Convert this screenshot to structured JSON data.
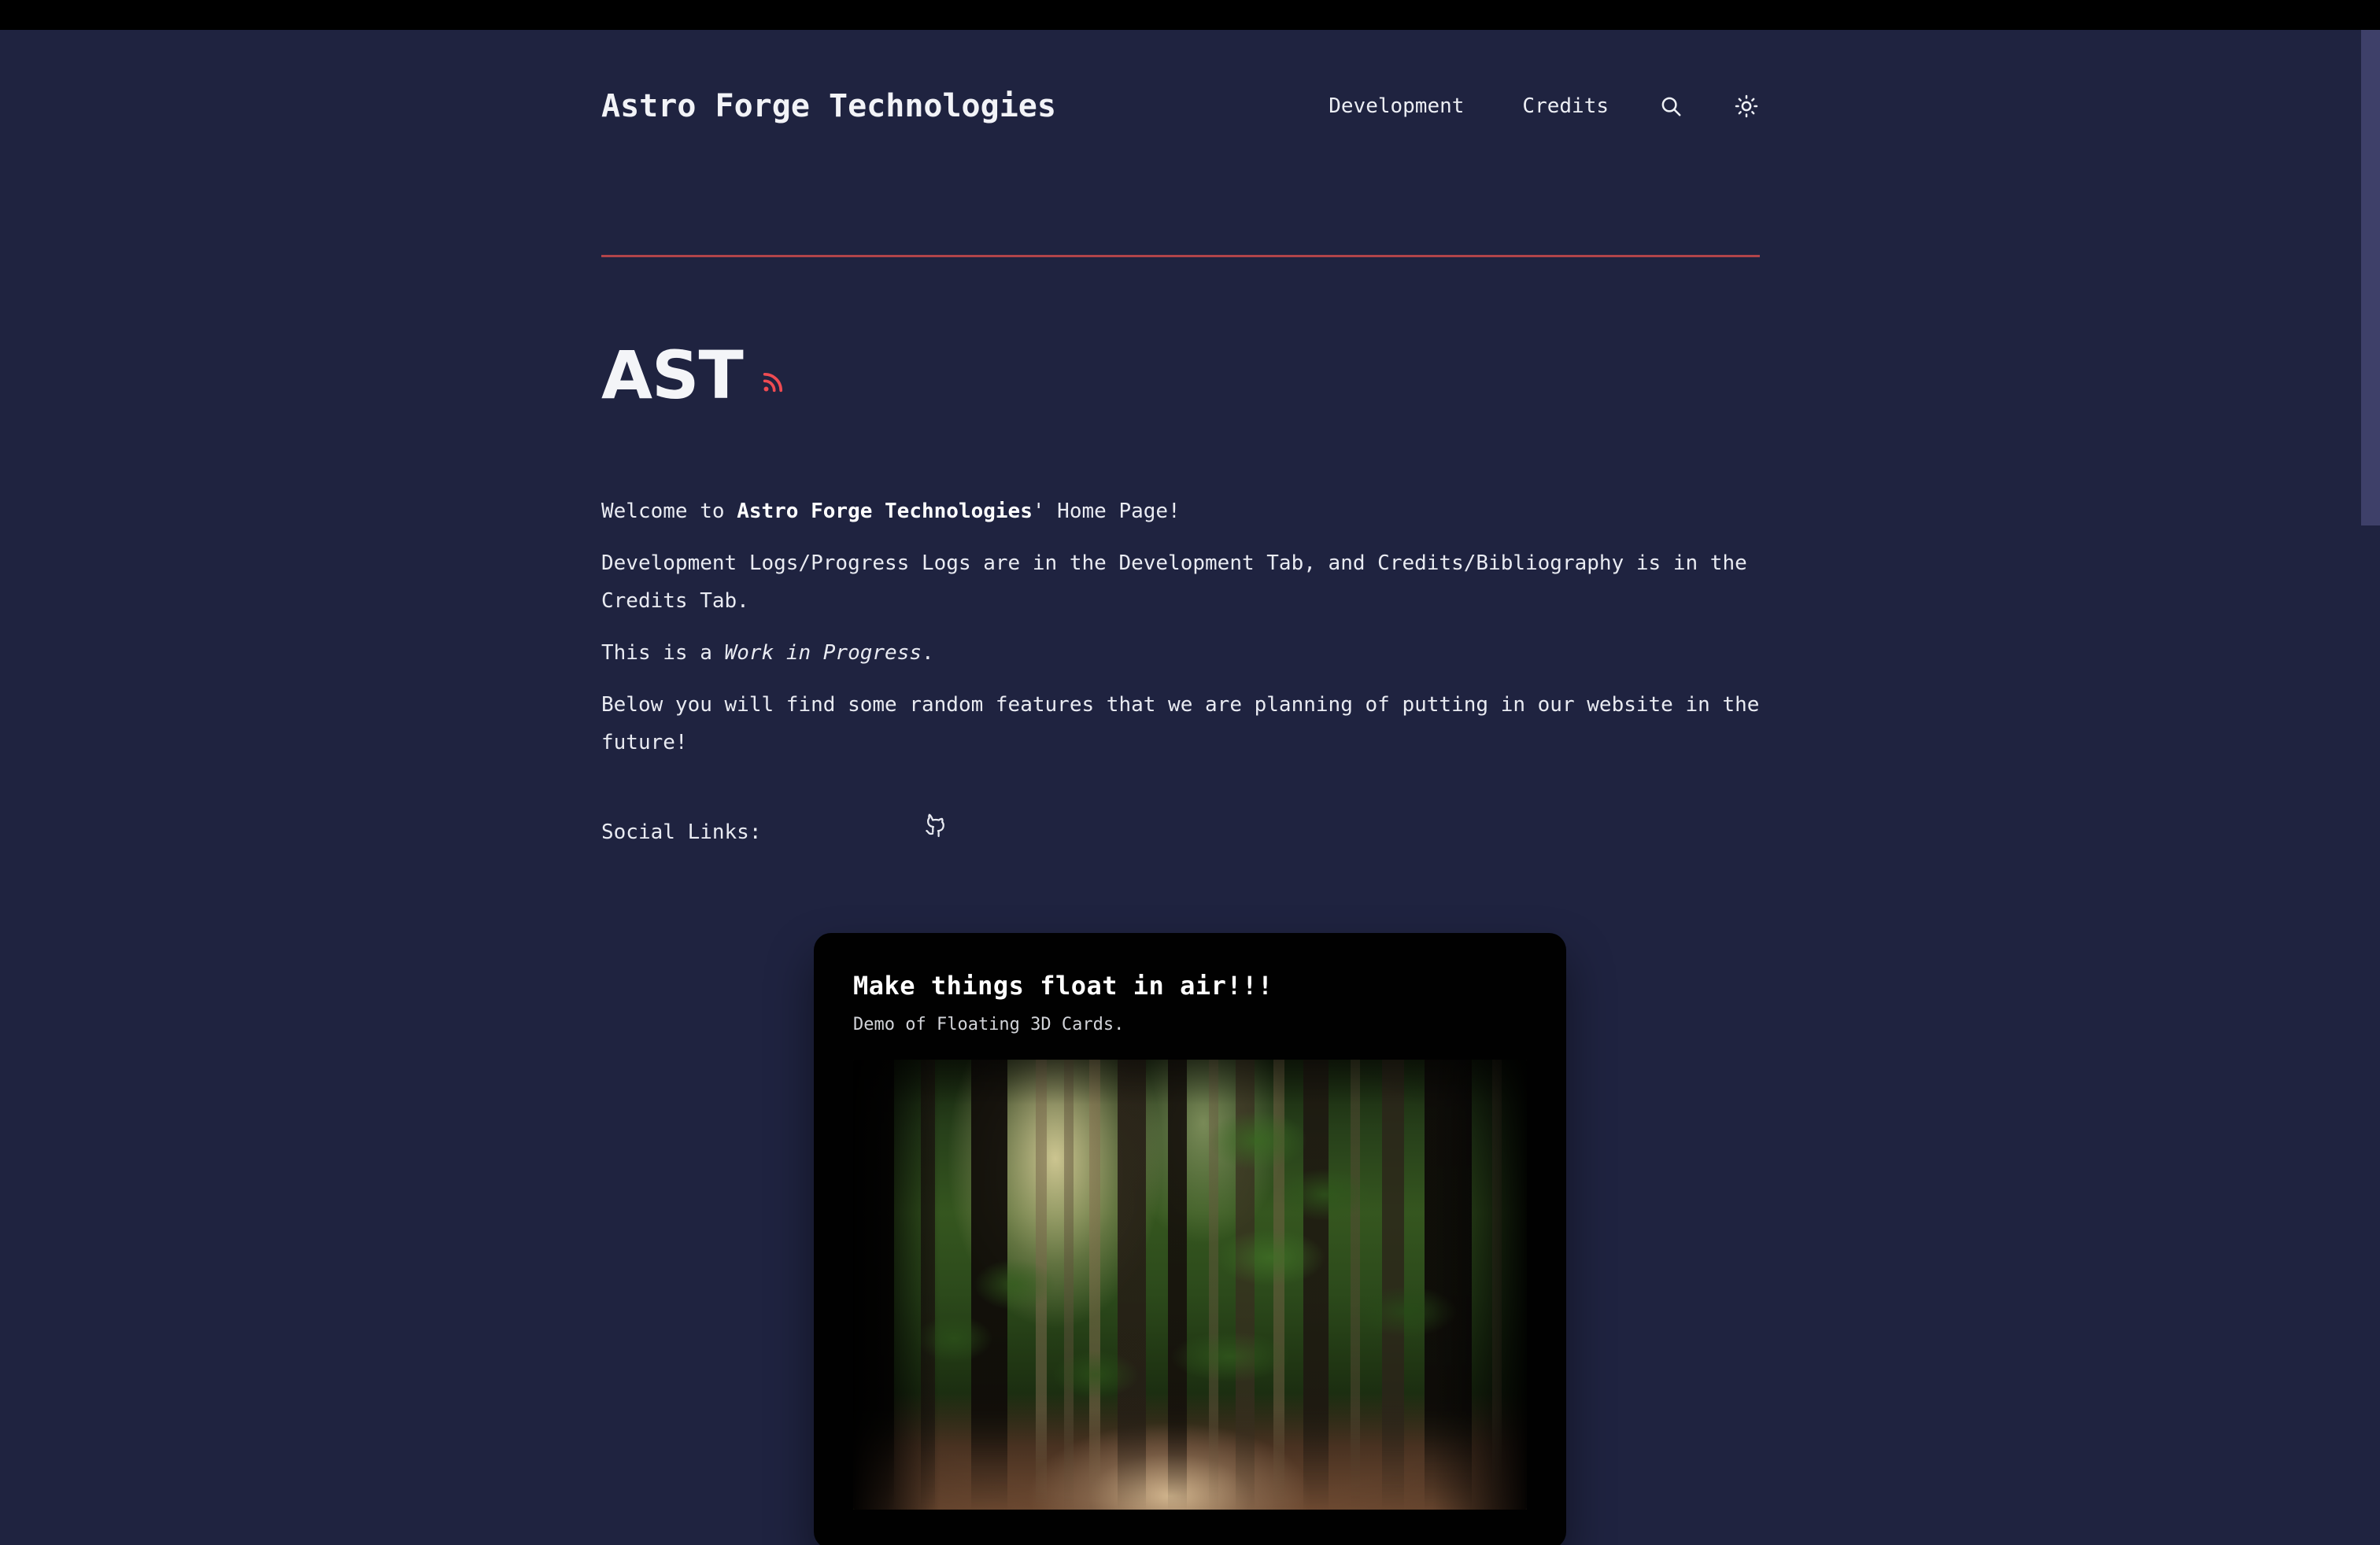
{
  "browser": {
    "chrome_bar_color": "#000000"
  },
  "theme": {
    "background": "#1f2340",
    "text": "#e9ebf2",
    "accent_rule": "#b1444a",
    "rss_accent": "#ef4b52",
    "card_background": "#010101",
    "scrollbar_thumb": "#3e4069"
  },
  "header": {
    "site_title": "Astro Forge Technologies",
    "nav": [
      {
        "label": "Development",
        "name": "nav-link-development"
      },
      {
        "label": "Credits",
        "name": "nav-link-credits"
      }
    ],
    "search_icon": "search-icon",
    "theme_toggle_icon": "sun-icon"
  },
  "hero": {
    "title": "AST",
    "rss_icon": "rss-icon"
  },
  "content": {
    "welcome_prefix": "Welcome to ",
    "welcome_brand": "Astro Forge Technologies",
    "welcome_suffix": "' Home Page!",
    "paragraph_logs": "Development Logs/Progress Logs are in the Development Tab, and Credits/Bibliography is in the Credits Tab.",
    "wip_prefix": "This is a ",
    "wip_emphasis": "Work in Progress",
    "wip_suffix": ".",
    "paragraph_features": "Below you will find some random features that we are planning of putting in our website in the future!",
    "social_label": "Social Links:",
    "social_icon": "github-icon"
  },
  "card": {
    "title": "Make things float in air!!!",
    "subtitle": "Demo of Floating 3D Cards.",
    "image_alt": "forest-path-photo"
  }
}
